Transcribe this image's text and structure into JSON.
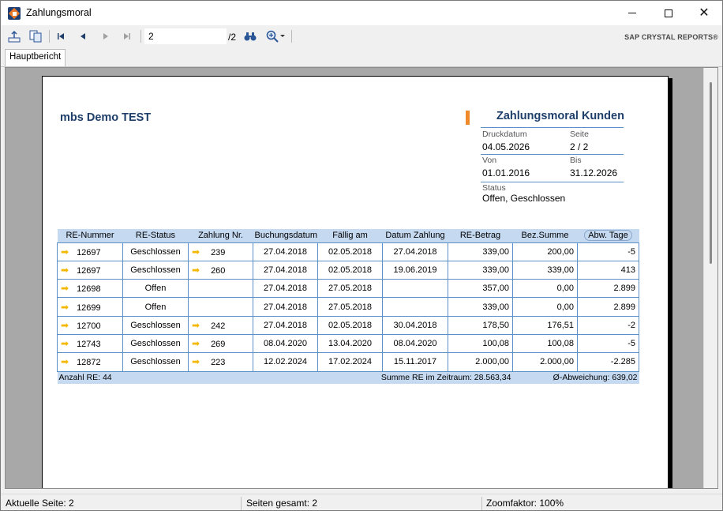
{
  "window": {
    "title": "Zahlungsmoral",
    "minimize_glyph": "—",
    "maximize_glyph": "☐",
    "close_glyph": "✕"
  },
  "toolbar": {
    "export_icon": "export-icon",
    "copy_icon": "copy-icon",
    "first_icon": "first-page-icon",
    "prev_icon": "previous-page-icon",
    "next_icon": "next-page-icon",
    "last_icon": "last-page-icon",
    "page_value": "2",
    "page_total": "/2",
    "find_icon": "binoculars-icon",
    "zoom_icon": "zoom-icon",
    "brand": "SAP CRYSTAL REPORTS®"
  },
  "tabs": [
    {
      "label": "Hauptbericht"
    }
  ],
  "report": {
    "company": "mbs Demo TEST",
    "title": "Zahlungsmoral Kunden",
    "druckdatum_label": "Druckdatum",
    "druckdatum": "04.05.2026",
    "seite_label": "Seite",
    "seite": "2 / 2",
    "von_label": "Von",
    "von": "01.01.2016",
    "bis_label": "Bis",
    "bis": "31.12.2026",
    "status_label": "Status",
    "status": "Offen, Geschlossen",
    "accent_color": "#f0892a",
    "header_color": "#c5d9f1",
    "columns": [
      "RE-Nummer",
      "RE-Status",
      "Zahlung Nr.",
      "Buchungsdatum",
      "Fällig am",
      "Datum Zahlung",
      "RE-Betrag",
      "Bez.Summe",
      "Abw. Tage"
    ],
    "rows": [
      [
        "12697",
        "Geschlossen",
        "239",
        "27.04.2018",
        "02.05.2018",
        "27.04.2018",
        "339,00",
        "200,00",
        "-5"
      ],
      [
        "12697",
        "Geschlossen",
        "260",
        "27.04.2018",
        "02.05.2018",
        "19.06.2019",
        "339,00",
        "339,00",
        "413"
      ],
      [
        "12698",
        "Offen",
        "",
        "27.04.2018",
        "27.05.2018",
        "",
        "357,00",
        "0,00",
        "2.899"
      ],
      [
        "12699",
        "Offen",
        "",
        "27.04.2018",
        "27.05.2018",
        "",
        "339,00",
        "0,00",
        "2.899"
      ],
      [
        "12700",
        "Geschlossen",
        "242",
        "27.04.2018",
        "02.05.2018",
        "30.04.2018",
        "178,50",
        "176,51",
        "-2"
      ],
      [
        "12743",
        "Geschlossen",
        "269",
        "08.04.2020",
        "13.04.2020",
        "08.04.2020",
        "100,08",
        "100,08",
        "-5"
      ],
      [
        "12872",
        "Geschlossen",
        "223",
        "12.02.2024",
        "17.02.2024",
        "15.11.2017",
        "2.000,00",
        "2.000,00",
        "-2.285"
      ]
    ],
    "footer": {
      "anzahl": "Anzahl RE: 44",
      "summe": "Summe RE im Zeitraum: 28.563,34",
      "abweichung": "Ø-Abweichung: 639,02"
    }
  },
  "statusbar": {
    "current_page": "Aktuelle Seite: 2",
    "total_pages": "Seiten gesamt: 2",
    "zoom": "Zoomfaktor: 100%"
  }
}
